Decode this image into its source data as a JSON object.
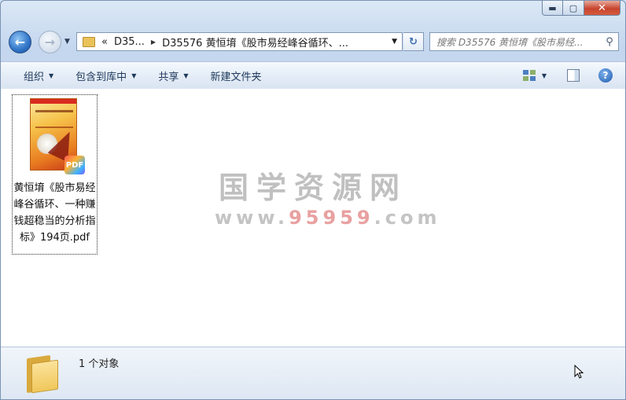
{
  "window": {
    "caption": {
      "minimize": "▬",
      "maximize": "▢",
      "close": "✕"
    }
  },
  "nav": {
    "back_glyph": "←",
    "forward_glyph": "→",
    "history_caret": "▼",
    "breadcrumb": [
      "«",
      "D35...",
      "D35576 黄恒堉《股市易经峰谷循环、..."
    ],
    "breadcrumb_arrow": "▶",
    "address_caret": "▼",
    "refresh_glyph": "↻",
    "search_placeholder": "搜索 D35576 黄恒堉《股市易经...",
    "search_glyph": "⚲"
  },
  "toolbar": {
    "organize": "组织",
    "include_in_library": "包含到库中",
    "share": "共享",
    "new_folder": "新建文件夹",
    "caret": "▼",
    "help": "?"
  },
  "files": [
    {
      "name": "黄恒堉《股市易经峰谷循环、一种赚钱超稳当的分析指标》194页.pdf",
      "badge": "PDF",
      "icon": "pdf-document-icon"
    }
  ],
  "watermark": {
    "title": "国学资源网",
    "url_prefix": "www.",
    "url_highlight": "95959",
    "url_suffix": ".com"
  },
  "status": {
    "count_text": "1 个对象"
  },
  "colors": {
    "accent": "#1e395b",
    "window_frame": "#7a93b3",
    "close_button": "#c7452f"
  }
}
